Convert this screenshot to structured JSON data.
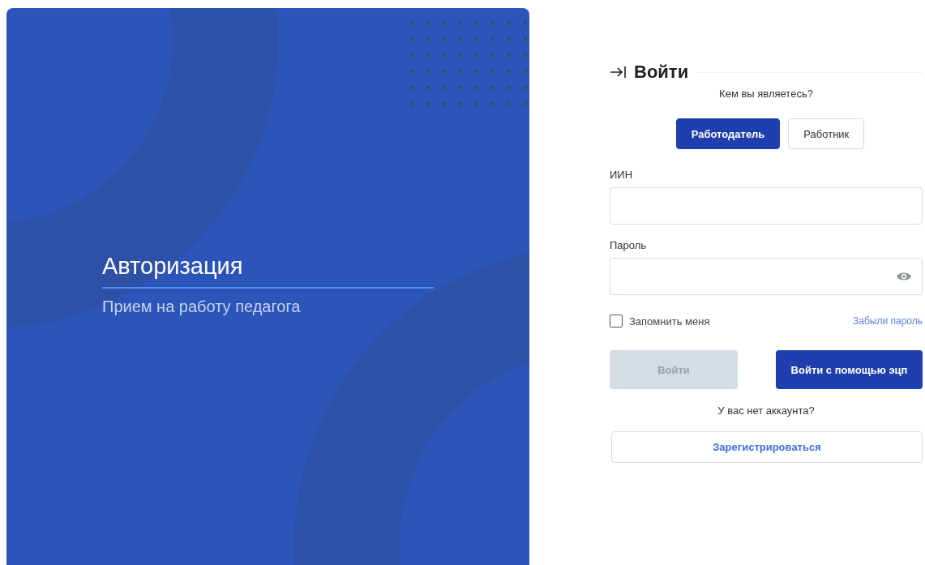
{
  "hero": {
    "title": "Авторизация",
    "subtitle": "Прием на работу педагога"
  },
  "login": {
    "title": "Войти",
    "role_prompt": "Кем вы являетесь?",
    "roles": [
      {
        "label": "Работодатель",
        "selected": true
      },
      {
        "label": "Работник",
        "selected": false
      }
    ],
    "iin": {
      "label": "ИИН"
    },
    "password": {
      "label": "Пароль"
    },
    "remember": {
      "label": "Запомнить меня",
      "checked": false
    },
    "forgot_link": "Забыли пароль",
    "submit": {
      "label": "Войти",
      "disabled": true
    },
    "eds_button": "Войти с помощью эцп",
    "no_account": "У вас нет аккаунта?",
    "register_button": "Зарегистрироваться"
  }
}
